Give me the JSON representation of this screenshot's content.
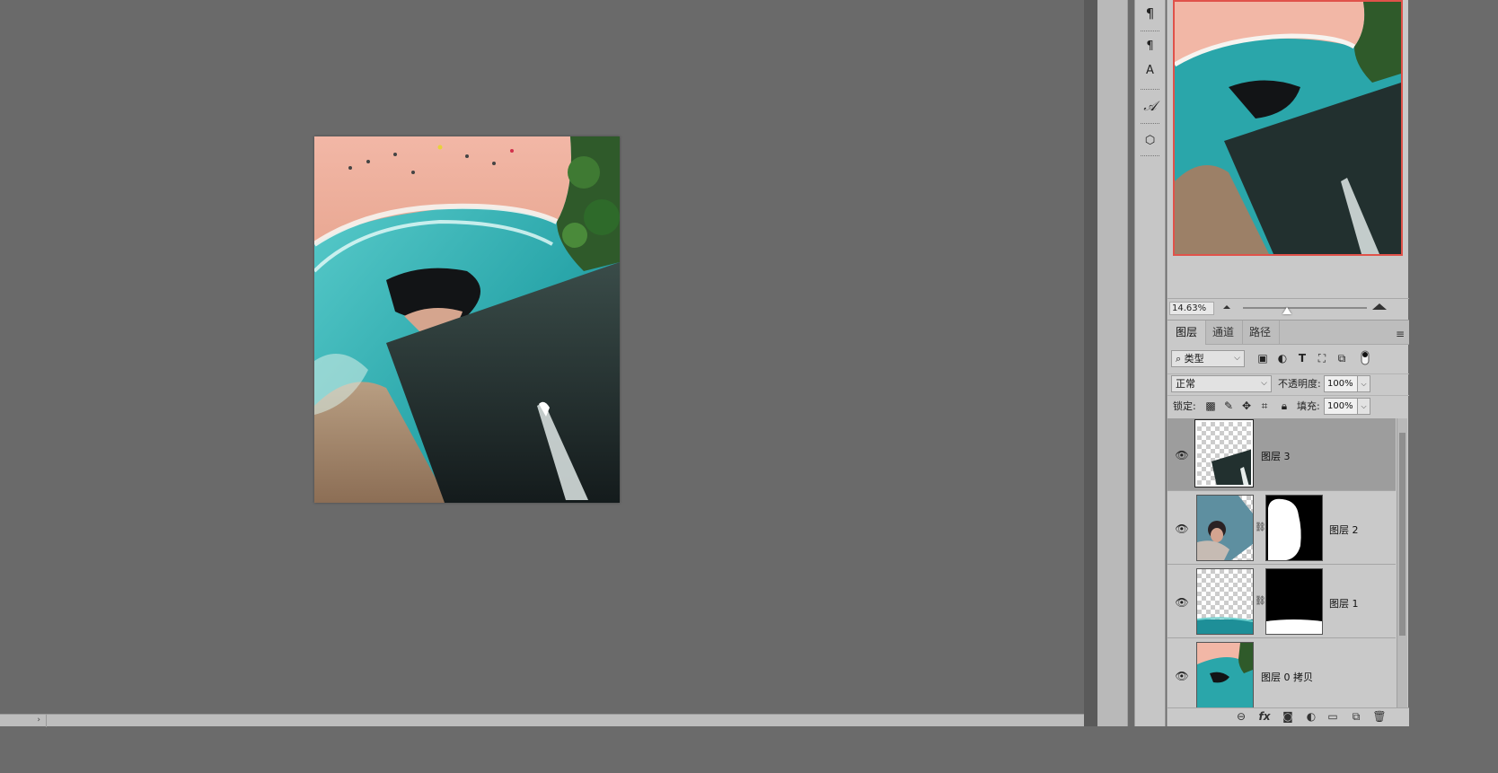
{
  "statusbar": {
    "nav_arrow": "›"
  },
  "toolstrip": {
    "items": [
      {
        "name": "paragraph-icon",
        "glyph": "¶"
      },
      {
        "name": "paragraph-styles-icon",
        "glyph": "¶"
      },
      {
        "name": "character-styles-icon",
        "glyph": "A"
      },
      {
        "name": "glyphs-icon",
        "glyph": "𝒜"
      },
      {
        "name": "3d-cube-icon",
        "glyph": "⬡"
      }
    ]
  },
  "navigator": {
    "zoom": "14.63%"
  },
  "layers_panel": {
    "tabs": [
      "图层",
      "通道",
      "路径"
    ],
    "filter": {
      "kind": "类型"
    },
    "blend_mode": "正常",
    "opacity_label": "不透明度:",
    "opacity_value": "100%",
    "lock_label": "锁定:",
    "fill_label": "填充:",
    "fill_value": "100%",
    "layers": [
      {
        "name": "图层 3",
        "selected": true,
        "has_mask": false
      },
      {
        "name": "图层 2",
        "selected": false,
        "has_mask": true
      },
      {
        "name": "图层 1",
        "selected": false,
        "has_mask": true
      },
      {
        "name": "图层 0 拷贝",
        "selected": false,
        "has_mask": false
      }
    ],
    "bottom_icons": [
      "link-layers-icon",
      "fx-icon",
      "add-mask-icon",
      "adjustment-icon",
      "group-icon",
      "new-layer-icon",
      "trash-icon"
    ],
    "fx_label": "fx"
  }
}
